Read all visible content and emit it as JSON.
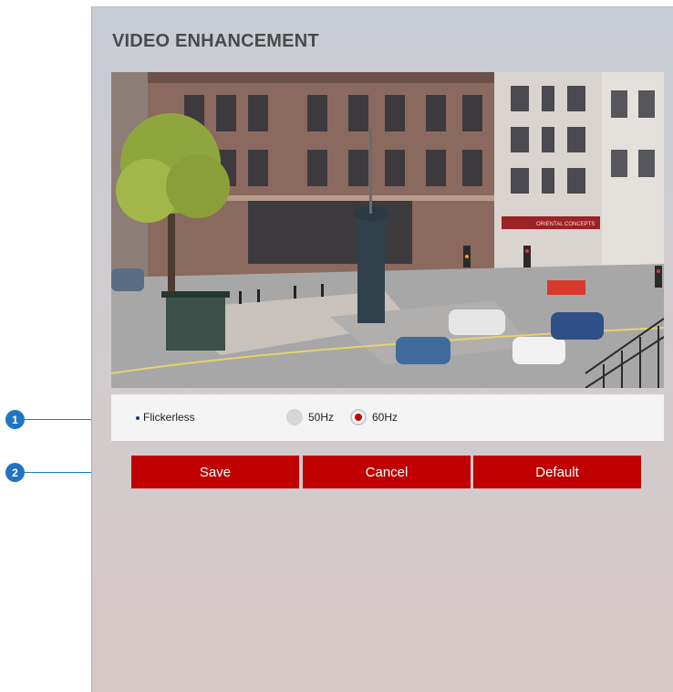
{
  "panel": {
    "title": "VIDEO ENHANCEMENT"
  },
  "video": {
    "storefront_sign": "ORIENTAL CONCEPTS"
  },
  "flickerless": {
    "label": "Flickerless",
    "options": [
      {
        "label": "50Hz",
        "selected": false
      },
      {
        "label": "60Hz",
        "selected": true
      }
    ]
  },
  "buttons": {
    "save": "Save",
    "cancel": "Cancel",
    "default": "Default"
  },
  "callouts": [
    "1",
    "2"
  ],
  "colors": {
    "accent_red": "#c00000",
    "callout_blue": "#1e76c0"
  }
}
